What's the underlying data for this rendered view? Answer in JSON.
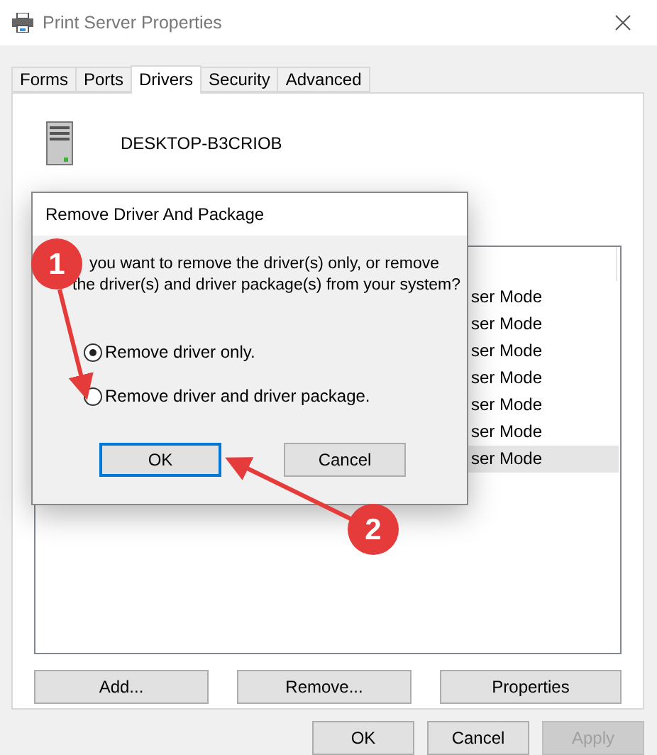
{
  "window": {
    "title": "Print Server Properties"
  },
  "tabs": [
    {
      "label": "Forms",
      "selected": false
    },
    {
      "label": "Ports",
      "selected": false
    },
    {
      "label": "Drivers",
      "selected": true
    },
    {
      "label": "Security",
      "selected": false
    },
    {
      "label": "Advanced",
      "selected": false
    }
  ],
  "server_name": "DESKTOP-B3CRIOB",
  "driver_list": {
    "rows": [
      {
        "column_2": "ser Mode",
        "selected": false
      },
      {
        "column_2": "ser Mode",
        "selected": false
      },
      {
        "column_2": "ser Mode",
        "selected": false
      },
      {
        "column_2": "ser Mode",
        "selected": false
      },
      {
        "column_2": "ser Mode",
        "selected": false
      },
      {
        "column_2": "ser Mode",
        "selected": false
      },
      {
        "column_2": "ser Mode",
        "selected": true
      }
    ]
  },
  "list_buttons": [
    {
      "label": "Add..."
    },
    {
      "label": "Remove..."
    },
    {
      "label": "Properties"
    }
  ],
  "footer_buttons": [
    {
      "label": "OK",
      "disabled": false
    },
    {
      "label": "Cancel",
      "disabled": false
    },
    {
      "label": "Apply",
      "disabled": true
    }
  ],
  "dialog": {
    "title": "Remove Driver And Package",
    "message_lines": [
      "you want to remove the driver(s) only, or remove",
      "the driver(s) and driver package(s) from your system?"
    ],
    "options": [
      {
        "label": "Remove driver only.",
        "selected": true
      },
      {
        "label": "Remove driver and driver package.",
        "selected": false
      }
    ],
    "buttons": [
      {
        "label": "OK",
        "focused": true
      },
      {
        "label": "Cancel",
        "focused": false
      }
    ]
  },
  "annotations": [
    {
      "label": "1"
    },
    {
      "label": "2"
    }
  ]
}
